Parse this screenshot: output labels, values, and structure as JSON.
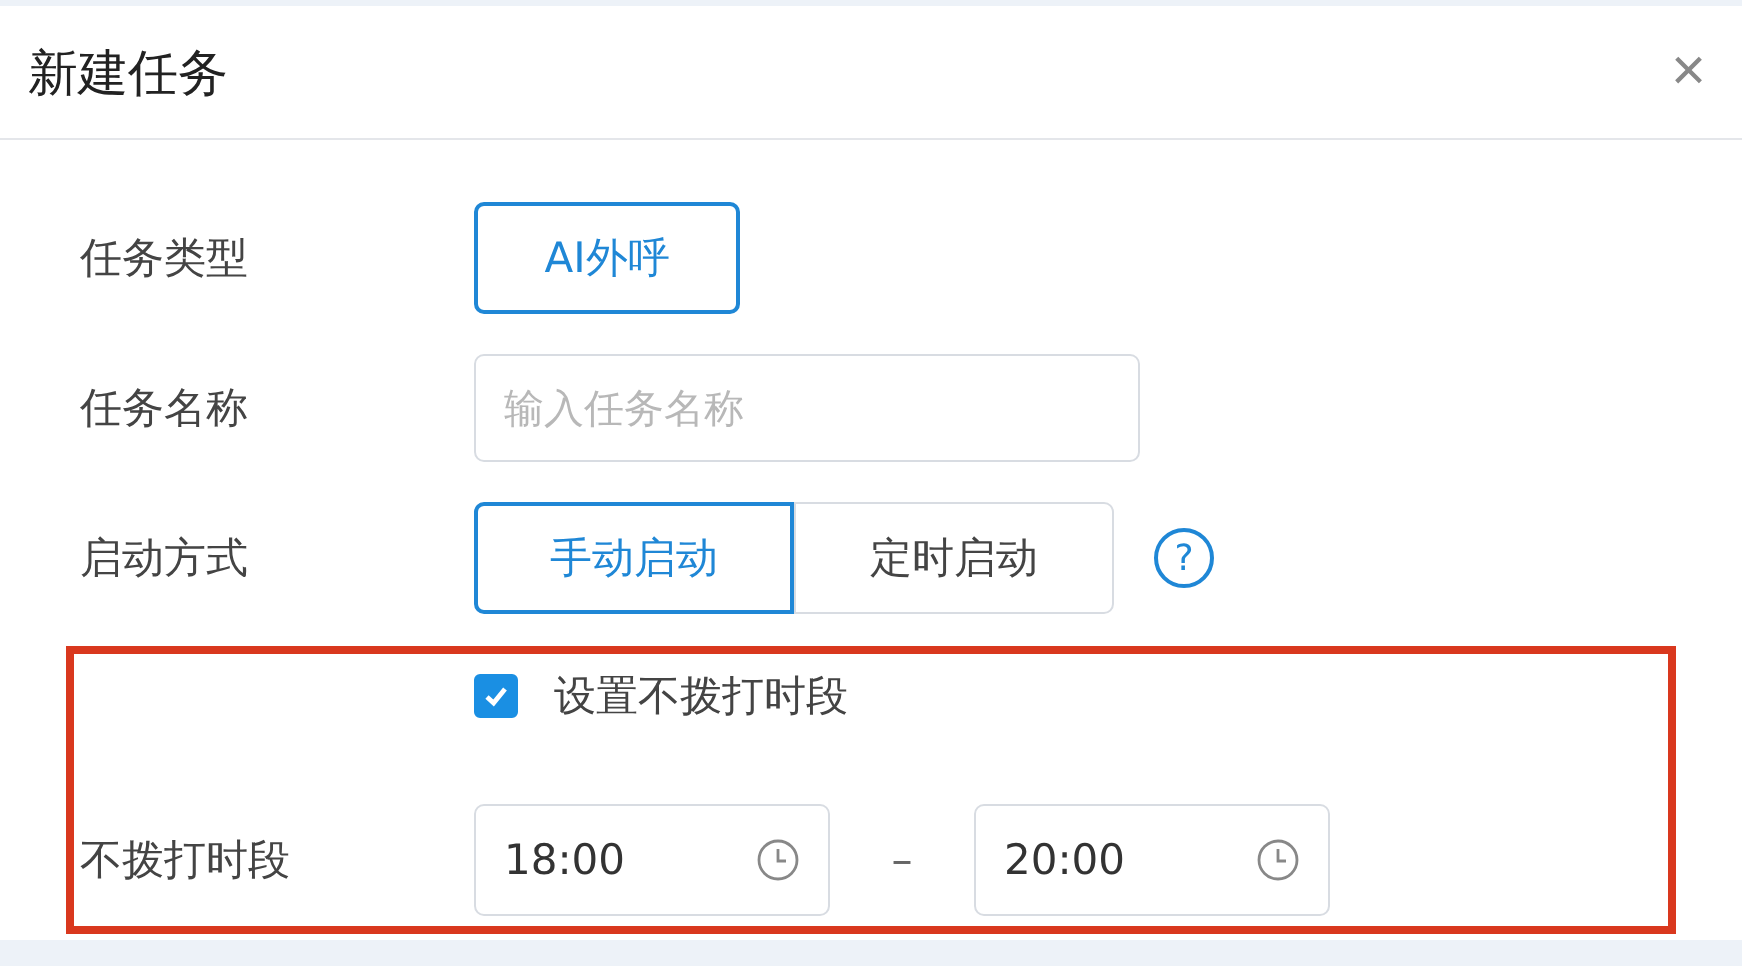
{
  "dialog": {
    "title": "新建任务",
    "close": "×"
  },
  "fields": [
    {
      "kind": "button",
      "label": "任务类型",
      "value": "AI外呼"
    },
    {
      "kind": "input",
      "label": "任务名称",
      "placeholder": "输入任务名称"
    },
    {
      "kind": "segmented",
      "label": "启动方式",
      "options": [
        {
          "label": "手动启动",
          "selected": true
        },
        {
          "label": "定时启动",
          "selected": false
        }
      ],
      "help": "?"
    }
  ],
  "quiet_hours": {
    "highlighted": true,
    "checkbox": {
      "label": "设置不拨打时段",
      "checked": true
    },
    "label": "不拨打时段",
    "start": "18:00",
    "separator": "–",
    "end": "20:00"
  }
}
